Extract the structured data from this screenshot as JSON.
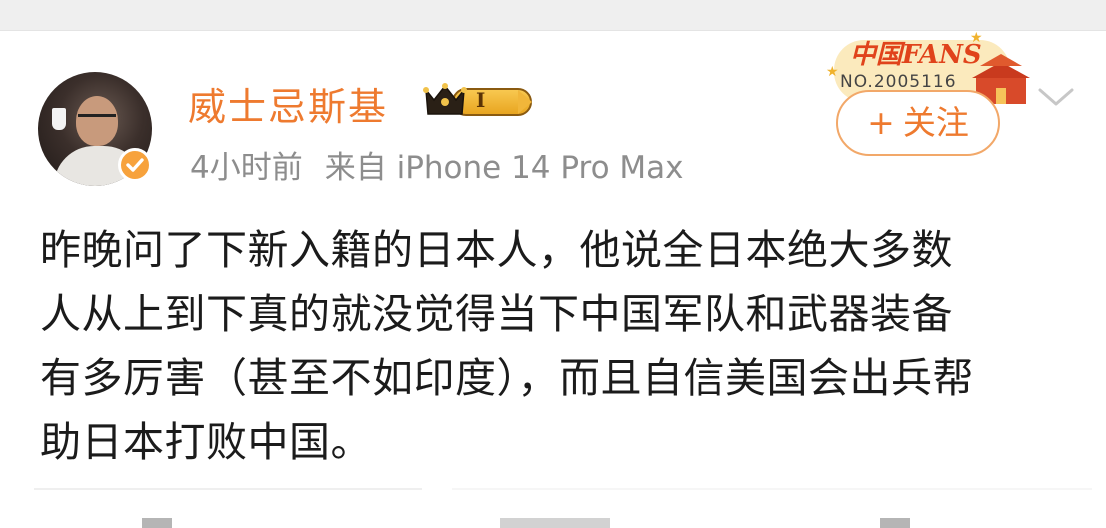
{
  "post": {
    "author": {
      "name": "威士忌斯基",
      "verified": true,
      "level": "I",
      "accent_color": "#ee7a2f"
    },
    "meta": {
      "time": "4小时前",
      "source": "来自 iPhone 14 Pro Max"
    },
    "fans_stamp": {
      "logo": "中国FANS",
      "number": "NO.2005116"
    },
    "follow_button": {
      "plus": "+",
      "label": "关注"
    },
    "body_lines": [
      "昨晚问了下新入籍的日本人，他说全日本绝大多数",
      "人从上到下真的就没觉得当下中国军队和武器装备",
      "有多厉害（甚至不如印度），而且自信美国会出兵帮",
      "助日本打败中国。"
    ]
  },
  "icons": {
    "verified": "verified-badge-icon",
    "crown": "crown-icon",
    "chevron": "chevron-down-icon"
  },
  "colors": {
    "username": "#ee7a2f",
    "follow_border": "#f2a869",
    "meta_text": "#8d8d8d",
    "body_text": "#1b1b1b",
    "verified_badge": "#f7a23c"
  }
}
